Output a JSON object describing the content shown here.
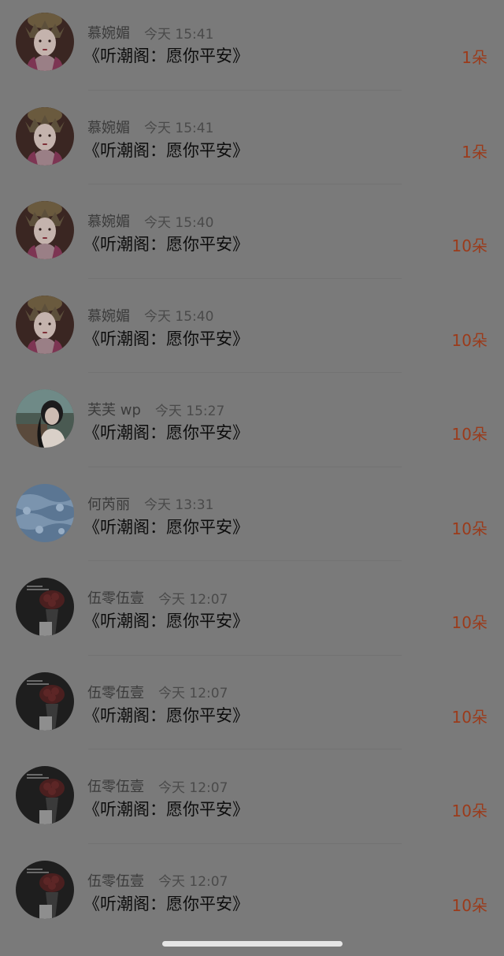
{
  "items": [
    {
      "name": "慕婉媚",
      "time": "今天 15:41",
      "gift": "《听潮阁：愿你平安》",
      "count": "1朵",
      "avatar": "avatar-ancient-costume"
    },
    {
      "name": "慕婉媚",
      "time": "今天 15:41",
      "gift": "《听潮阁：愿你平安》",
      "count": "1朵",
      "avatar": "avatar-ancient-costume"
    },
    {
      "name": "慕婉媚",
      "time": "今天 15:40",
      "gift": "《听潮阁：愿你平安》",
      "count": "10朵",
      "avatar": "avatar-ancient-costume"
    },
    {
      "name": "慕婉媚",
      "time": "今天 15:40",
      "gift": "《听潮阁：愿你平安》",
      "count": "10朵",
      "avatar": "avatar-ancient-costume"
    },
    {
      "name": "芙芙 wp",
      "time": "今天 15:27",
      "gift": "《听潮阁：愿你平安》",
      "count": "10朵",
      "avatar": "avatar-portrait"
    },
    {
      "name": "何芮丽",
      "time": "今天 13:31",
      "gift": "《听潮阁：愿你平安》",
      "count": "10朵",
      "avatar": "avatar-wave-pattern"
    },
    {
      "name": "伍零伍壹",
      "time": "今天 12:07",
      "gift": "《听潮阁：愿你平安》",
      "count": "10朵",
      "avatar": "avatar-rose-bouquet"
    },
    {
      "name": "伍零伍壹",
      "time": "今天 12:07",
      "gift": "《听潮阁：愿你平安》",
      "count": "10朵",
      "avatar": "avatar-rose-bouquet"
    },
    {
      "name": "伍零伍壹",
      "time": "今天 12:07",
      "gift": "《听潮阁：愿你平安》",
      "count": "10朵",
      "avatar": "avatar-rose-bouquet"
    },
    {
      "name": "伍零伍壹",
      "time": "今天 12:07",
      "gift": "《听潮阁：愿你平安》",
      "count": "10朵",
      "avatar": "avatar-rose-bouquet"
    }
  ],
  "colors": {
    "background": "#7a7a7a",
    "count_accent": "#9b3b1b",
    "home_indicator": "#e5e5e5"
  }
}
